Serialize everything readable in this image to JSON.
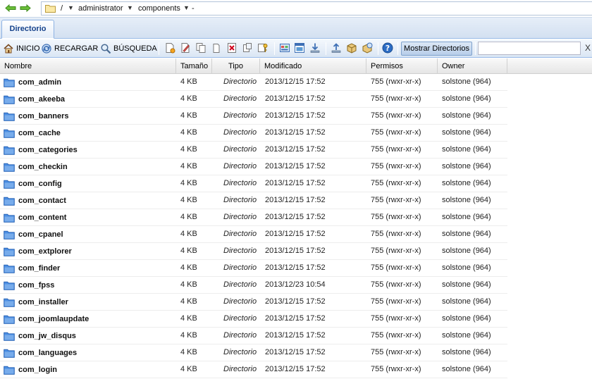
{
  "path": {
    "root": "/",
    "segments": [
      "administrator",
      "components"
    ],
    "trailing_marker": "-"
  },
  "tabs": [
    {
      "label": "Directorio",
      "active": true
    }
  ],
  "toolbar": {
    "home_label": "INICIO",
    "reload_label": "RECARGAR",
    "search_label": "BÚSQUEDA",
    "show_dirs_label": "Mostrar Directorios",
    "filter_value": "",
    "clear_label": "X"
  },
  "columns": {
    "name": "Nombre",
    "size": "Tamaño",
    "type": "Tipo",
    "modified": "Modificado",
    "perms": "Permisos",
    "owner": "Owner"
  },
  "rows": [
    {
      "name": "com_admin",
      "size": "4 KB",
      "type": "Directorio",
      "modified": "2013/12/15 17:52",
      "perms": "755 (rwxr-xr-x)",
      "owner": "solstone (964)"
    },
    {
      "name": "com_akeeba",
      "size": "4 KB",
      "type": "Directorio",
      "modified": "2013/12/15 17:52",
      "perms": "755 (rwxr-xr-x)",
      "owner": "solstone (964)"
    },
    {
      "name": "com_banners",
      "size": "4 KB",
      "type": "Directorio",
      "modified": "2013/12/15 17:52",
      "perms": "755 (rwxr-xr-x)",
      "owner": "solstone (964)"
    },
    {
      "name": "com_cache",
      "size": "4 KB",
      "type": "Directorio",
      "modified": "2013/12/15 17:52",
      "perms": "755 (rwxr-xr-x)",
      "owner": "solstone (964)"
    },
    {
      "name": "com_categories",
      "size": "4 KB",
      "type": "Directorio",
      "modified": "2013/12/15 17:52",
      "perms": "755 (rwxr-xr-x)",
      "owner": "solstone (964)"
    },
    {
      "name": "com_checkin",
      "size": "4 KB",
      "type": "Directorio",
      "modified": "2013/12/15 17:52",
      "perms": "755 (rwxr-xr-x)",
      "owner": "solstone (964)"
    },
    {
      "name": "com_config",
      "size": "4 KB",
      "type": "Directorio",
      "modified": "2013/12/15 17:52",
      "perms": "755 (rwxr-xr-x)",
      "owner": "solstone (964)"
    },
    {
      "name": "com_contact",
      "size": "4 KB",
      "type": "Directorio",
      "modified": "2013/12/15 17:52",
      "perms": "755 (rwxr-xr-x)",
      "owner": "solstone (964)"
    },
    {
      "name": "com_content",
      "size": "4 KB",
      "type": "Directorio",
      "modified": "2013/12/15 17:52",
      "perms": "755 (rwxr-xr-x)",
      "owner": "solstone (964)"
    },
    {
      "name": "com_cpanel",
      "size": "4 KB",
      "type": "Directorio",
      "modified": "2013/12/15 17:52",
      "perms": "755 (rwxr-xr-x)",
      "owner": "solstone (964)"
    },
    {
      "name": "com_extplorer",
      "size": "4 KB",
      "type": "Directorio",
      "modified": "2013/12/15 17:52",
      "perms": "755 (rwxr-xr-x)",
      "owner": "solstone (964)"
    },
    {
      "name": "com_finder",
      "size": "4 KB",
      "type": "Directorio",
      "modified": "2013/12/15 17:52",
      "perms": "755 (rwxr-xr-x)",
      "owner": "solstone (964)"
    },
    {
      "name": "com_fpss",
      "size": "4 KB",
      "type": "Directorio",
      "modified": "2013/12/23 10:54",
      "perms": "755 (rwxr-xr-x)",
      "owner": "solstone (964)"
    },
    {
      "name": "com_installer",
      "size": "4 KB",
      "type": "Directorio",
      "modified": "2013/12/15 17:52",
      "perms": "755 (rwxr-xr-x)",
      "owner": "solstone (964)"
    },
    {
      "name": "com_joomlaupdate",
      "size": "4 KB",
      "type": "Directorio",
      "modified": "2013/12/15 17:52",
      "perms": "755 (rwxr-xr-x)",
      "owner": "solstone (964)"
    },
    {
      "name": "com_jw_disqus",
      "size": "4 KB",
      "type": "Directorio",
      "modified": "2013/12/15 17:52",
      "perms": "755 (rwxr-xr-x)",
      "owner": "solstone (964)"
    },
    {
      "name": "com_languages",
      "size": "4 KB",
      "type": "Directorio",
      "modified": "2013/12/15 17:52",
      "perms": "755 (rwxr-xr-x)",
      "owner": "solstone (964)"
    },
    {
      "name": "com_login",
      "size": "4 KB",
      "type": "Directorio",
      "modified": "2013/12/15 17:52",
      "perms": "755 (rwxr-xr-x)",
      "owner": "solstone (964)"
    }
  ],
  "icons": {
    "back": "arrow-left-icon",
    "forward": "arrow-right-icon",
    "folder": "folder-icon",
    "home": "home-icon",
    "reload": "reload-icon",
    "search": "magnifier-icon",
    "help": "help-icon"
  },
  "colors": {
    "accent": "#15428b",
    "toolbar_border": "#99bbe8",
    "folder_blue": "#3b7dd8"
  }
}
